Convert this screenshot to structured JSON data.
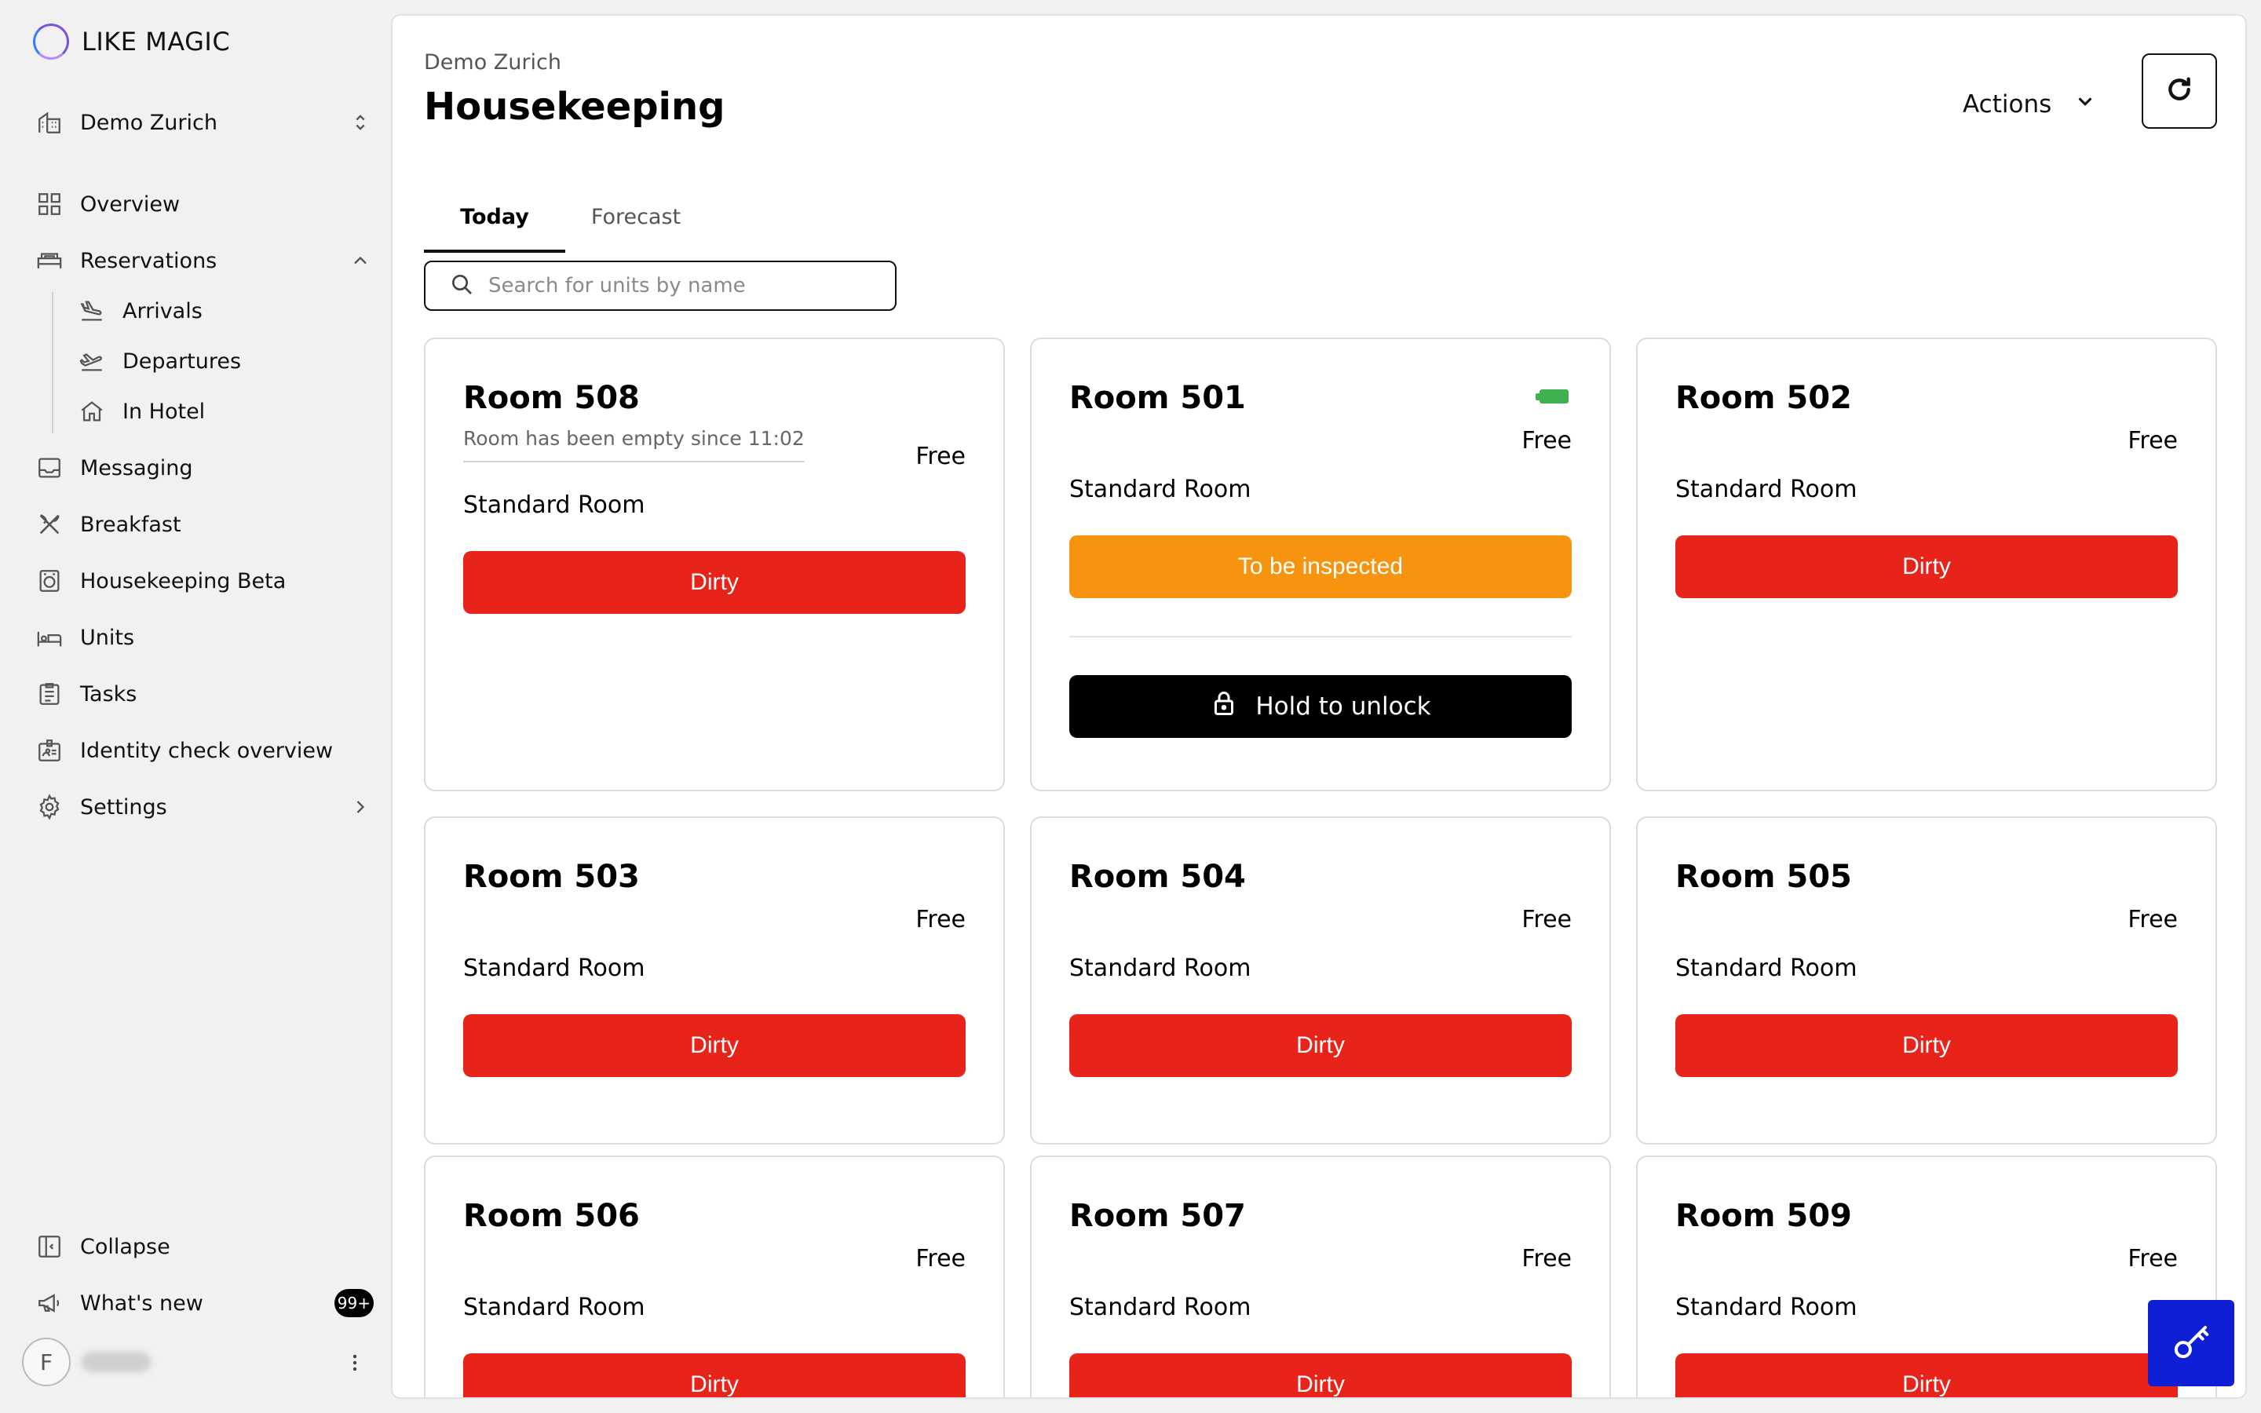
{
  "brand": {
    "name": "LIKE MAGIC"
  },
  "sidebar": {
    "property": {
      "label": "Demo Zurich",
      "icon": "building-icon"
    },
    "items": [
      {
        "label": "Overview",
        "icon": "grid-icon"
      },
      {
        "label": "Reservations",
        "icon": "bed-icon",
        "expanded": true
      },
      {
        "label": "Arrivals",
        "icon": "plane-landing-icon"
      },
      {
        "label": "Departures",
        "icon": "plane-departure-icon"
      },
      {
        "label": "In Hotel",
        "icon": "home-icon"
      },
      {
        "label": "Messaging",
        "icon": "inbox-icon"
      },
      {
        "label": "Breakfast",
        "icon": "utensils-icon"
      },
      {
        "label": "Housekeeping Beta",
        "icon": "washing-machine-icon"
      },
      {
        "label": "Units",
        "icon": "bed-single-icon"
      },
      {
        "label": "Tasks",
        "icon": "clipboard-icon"
      },
      {
        "label": "Identity check overview",
        "icon": "id-card-icon"
      },
      {
        "label": "Settings",
        "icon": "gear-icon"
      }
    ],
    "collapse_label": "Collapse",
    "whats_new_label": "What's new",
    "whats_new_badge": "99+",
    "user_initial": "F"
  },
  "header": {
    "breadcrumb": "Demo Zurich",
    "title": "Housekeeping",
    "actions_label": "Actions"
  },
  "tabs": [
    {
      "label": "Today",
      "active": true
    },
    {
      "label": "Forecast",
      "active": false
    }
  ],
  "search": {
    "placeholder": "Search for units by name",
    "value": ""
  },
  "rooms": [
    {
      "name": "Room 508",
      "note": "Room has been empty since 11:02",
      "status": "Free",
      "type": "Standard Room",
      "state": "Dirty"
    },
    {
      "name": "Room 501",
      "status": "Free",
      "type": "Standard Room",
      "state": "To be inspected",
      "unlock_label": "Hold to unlock",
      "battery": "full"
    },
    {
      "name": "Room 502",
      "status": "Free",
      "type": "Standard Room",
      "state": "Dirty"
    },
    {
      "name": "Room 503",
      "status": "Free",
      "type": "Standard Room",
      "state": "Dirty"
    },
    {
      "name": "Room 504",
      "status": "Free",
      "type": "Standard Room",
      "state": "Dirty"
    },
    {
      "name": "Room 505",
      "status": "Free",
      "type": "Standard Room",
      "state": "Dirty"
    },
    {
      "name": "Room 506",
      "status": "Free",
      "type": "Standard Room",
      "state": "Dirty"
    },
    {
      "name": "Room 507",
      "status": "Free",
      "type": "Standard Room",
      "state": "Dirty"
    },
    {
      "name": "Room 509",
      "status": "Free",
      "type": "Standard Room",
      "state": "Dirty"
    }
  ],
  "colors": {
    "dirty": "#e8231a",
    "to_be_inspected": "#f7940f",
    "unlock": "#000000",
    "battery": "#3fb24f",
    "key_fab": "#0f1fd6"
  }
}
